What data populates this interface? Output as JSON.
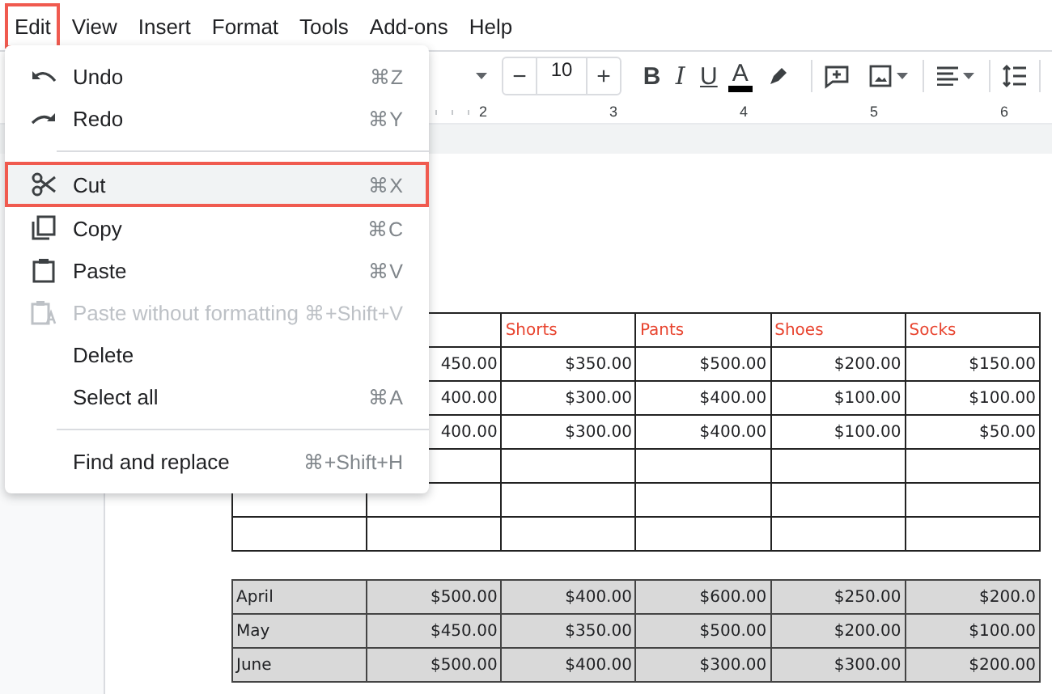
{
  "menubar": [
    {
      "label": "Edit",
      "selected": true
    },
    {
      "label": "View",
      "selected": false
    },
    {
      "label": "Insert",
      "selected": false
    },
    {
      "label": "Format",
      "selected": false
    },
    {
      "label": "Tools",
      "selected": false
    },
    {
      "label": "Add-ons",
      "selected": false
    },
    {
      "label": "Help",
      "selected": false
    }
  ],
  "toolbar": {
    "font_size": {
      "decrease": "−",
      "value": "10",
      "increase": "+"
    },
    "format_buttons": [
      "B",
      "I",
      "U",
      "A"
    ]
  },
  "ruler": {
    "numbers": [
      "2",
      "3",
      "4",
      "5",
      "6"
    ]
  },
  "edit_menu": {
    "sections": [
      [
        {
          "label": "Undo",
          "shortcut": "⌘Z",
          "highlighted": false,
          "disabled": false
        },
        {
          "label": "Redo",
          "shortcut": "⌘Y",
          "highlighted": false,
          "disabled": false
        }
      ],
      [
        {
          "label": "Cut",
          "shortcut": "⌘X",
          "highlighted": true,
          "disabled": false
        },
        {
          "label": "Copy",
          "shortcut": "⌘C",
          "highlighted": false,
          "disabled": false
        },
        {
          "label": "Paste",
          "shortcut": "⌘V",
          "highlighted": false,
          "disabled": false
        },
        {
          "label": "Paste without formatting",
          "shortcut": "⌘+Shift+V",
          "highlighted": false,
          "disabled": true
        },
        {
          "label": "Delete",
          "highlighted": false,
          "disabled": false
        },
        {
          "label": "Select all",
          "shortcut": "⌘A",
          "highlighted": false,
          "disabled": false
        }
      ],
      [
        {
          "label": "Find and replace",
          "shortcut": "⌘+Shift+H",
          "highlighted": false,
          "disabled": false
        }
      ]
    ]
  },
  "table_1": {
    "header": [
      "Shorts",
      "Pants",
      "Shoes",
      "Socks"
    ],
    "rows": [
      [
        "450.00",
        "$350.00",
        "$500.00",
        "$200.00",
        "$150.00"
      ],
      [
        "400.00",
        "$300.00",
        "$400.00",
        "$100.00",
        "$100.00"
      ],
      [
        "400.00",
        "$300.00",
        "$400.00",
        "$100.00",
        "$50.00"
      ]
    ]
  },
  "table_2": {
    "rows": [
      [
        "April",
        "$500.00",
        "$400.00",
        "$600.00",
        "$250.00",
        "$200.0"
      ],
      [
        "May",
        "$450.00",
        "$350.00",
        "$500.00",
        "$200.00",
        "$100.00"
      ],
      [
        "June",
        "$500.00",
        "$400.00",
        "$300.00",
        "$300.00",
        "$200.00"
      ]
    ]
  }
}
